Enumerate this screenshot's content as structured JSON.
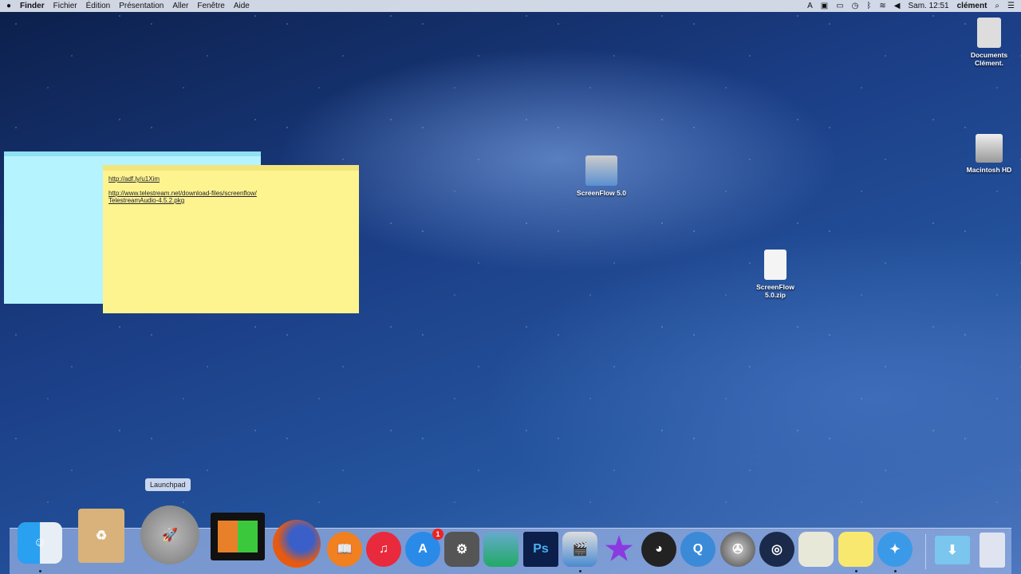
{
  "menubar": {
    "apple": "",
    "app": "Finder",
    "items": [
      "Fichier",
      "Édition",
      "Présentation",
      "Aller",
      "Fenêtre",
      "Aide"
    ],
    "clock": "Sam. 12:51",
    "user": "clément"
  },
  "desktop": {
    "icons": [
      {
        "label": "Documents Clément."
      },
      {
        "label": "Macintosh HD"
      },
      {
        "label": "ScreenFlow 5.0"
      },
      {
        "label": "ScreenFlow 5.0.zip"
      }
    ]
  },
  "note": {
    "links": [
      "http://adf.ly/u1Xim",
      "http://www.telestream.net/download-files/screenflow/",
      "TelestreamAudio-4.5.2.pkg"
    ]
  },
  "dock": {
    "tooltip": "Launchpad",
    "app_store_badge": "1",
    "ps_label": "Ps"
  }
}
